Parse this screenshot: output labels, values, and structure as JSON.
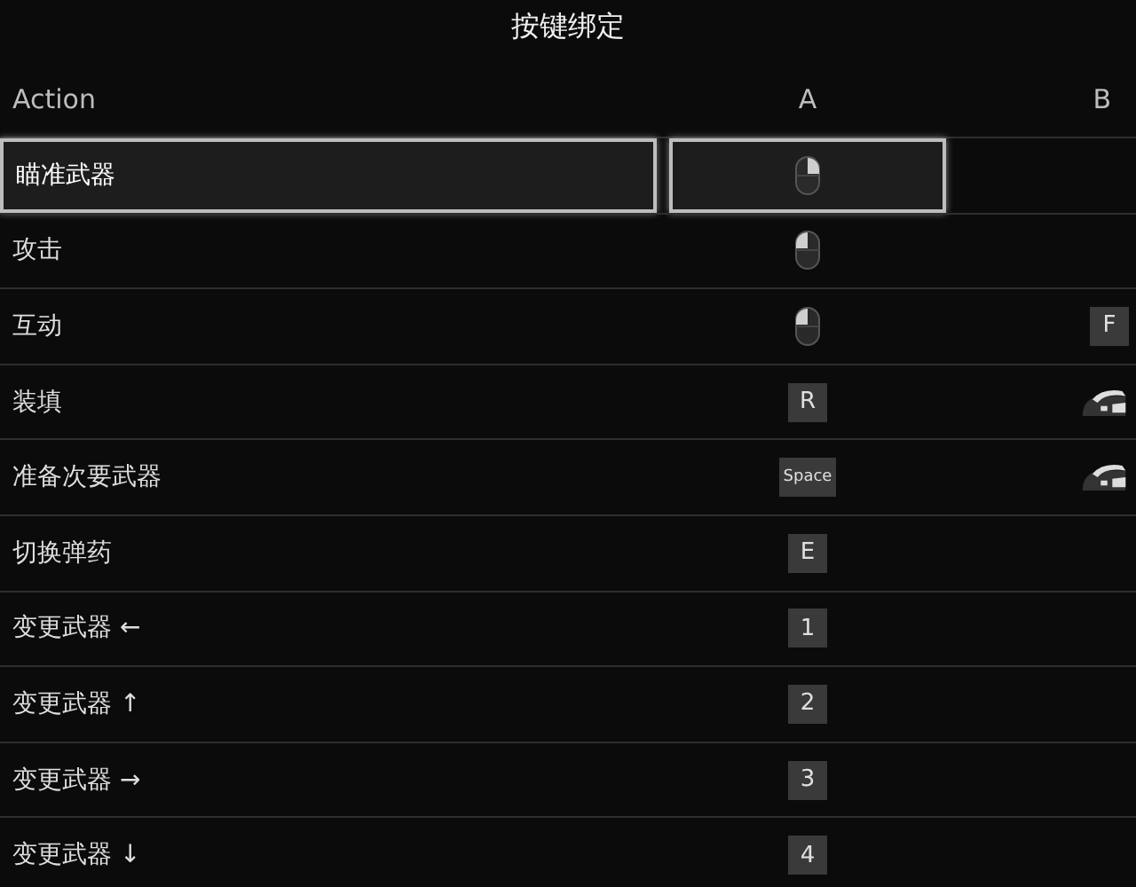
{
  "title": "按键绑定",
  "columns": [
    "Action",
    "A",
    "B"
  ],
  "rows": [
    {
      "action": "瞄准武器",
      "selected": true,
      "a": {
        "kind": "mouse_right",
        "selected": true
      }
    },
    {
      "action": "攻击",
      "selected": false,
      "a": {
        "kind": "mouse_left",
        "selected": false
      }
    },
    {
      "action": "互动",
      "selected": false,
      "a": {
        "kind": "mouse_left",
        "selected": false
      },
      "b": {
        "kind": "key",
        "label": "F",
        "selected": false
      }
    },
    {
      "action": "装填",
      "selected": false,
      "a": {
        "kind": "key",
        "label": "R",
        "selected": false
      },
      "b": {
        "kind": "mouse_side",
        "selected": false
      }
    },
    {
      "action": "准备次要武器",
      "selected": false,
      "a": {
        "kind": "key",
        "label": "Space",
        "selected": false
      },
      "b": {
        "kind": "mouse_side",
        "selected": false
      }
    },
    {
      "action": "切换弹药",
      "selected": false,
      "a": {
        "kind": "key",
        "label": "E",
        "selected": false
      }
    },
    {
      "action": "变更武器 ←",
      "selected": false,
      "a": {
        "kind": "key",
        "label": "1",
        "selected": false
      }
    },
    {
      "action": "变更武器 ↑",
      "selected": false,
      "a": {
        "kind": "key",
        "label": "2",
        "selected": false
      }
    },
    {
      "action": "变更武器 →",
      "selected": false,
      "a": {
        "kind": "key",
        "label": "3",
        "selected": false
      }
    },
    {
      "action": "变更武器 ↓",
      "selected": false,
      "a": {
        "kind": "key",
        "label": "4",
        "selected": false
      }
    }
  ]
}
